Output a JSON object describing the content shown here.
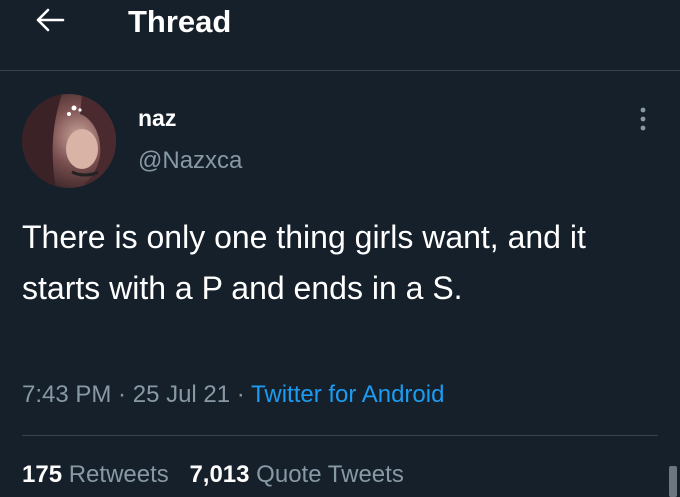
{
  "header": {
    "title": "Thread",
    "back_icon": "arrow-left-icon"
  },
  "tweet": {
    "author": {
      "display_name": "naz",
      "handle": "@Nazxca",
      "avatar_icon": "user-avatar"
    },
    "more_icon": "more-vertical-icon",
    "text": "There is only one thing girls want, and it starts with a P and ends in a S.",
    "time": "7:43 PM",
    "separator": " · ",
    "date": "25 Jul 21",
    "source": "Twitter for Android"
  },
  "stats": {
    "retweets_count": "175",
    "retweets_label": "Retweets",
    "quotes_count": "7,013",
    "quotes_label": "Quote Tweets"
  },
  "colors": {
    "background": "#15202b",
    "text_primary": "#ffffff",
    "text_secondary": "#8899a6",
    "accent": "#1d9bf0",
    "border": "#38444d"
  }
}
